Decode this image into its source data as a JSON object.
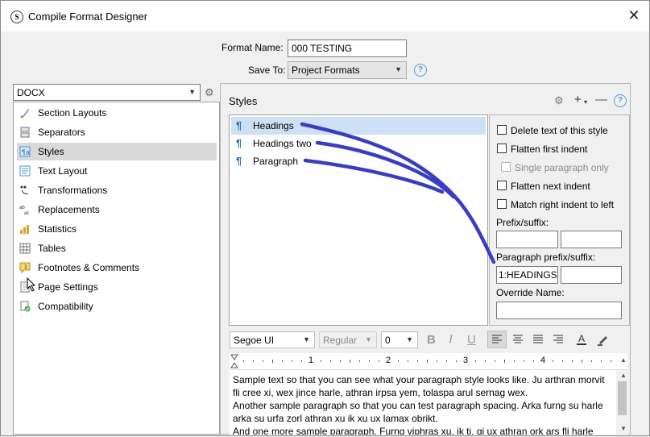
{
  "window": {
    "title": "Compile Format Designer",
    "close_label": "✕"
  },
  "header": {
    "format_name_label": "Format Name:",
    "format_name_value": "000 TESTING",
    "save_to_label": "Save To:",
    "save_to_value": "Project Formats"
  },
  "sidebar": {
    "format_value": "DOCX",
    "items": [
      {
        "label": "Section Layouts",
        "icon": "brush-icon"
      },
      {
        "label": "Separators",
        "icon": "separator-icon"
      },
      {
        "label": "Styles",
        "icon": "styles-icon",
        "selected": true
      },
      {
        "label": "Text Layout",
        "icon": "text-layout-icon"
      },
      {
        "label": "Transformations",
        "icon": "transformations-icon"
      },
      {
        "label": "Replacements",
        "icon": "replacements-icon"
      },
      {
        "label": "Statistics",
        "icon": "bar-chart-icon"
      },
      {
        "label": "Tables",
        "icon": "table-icon"
      },
      {
        "label": "Footnotes & Comments",
        "icon": "footnote-icon"
      },
      {
        "label": "Page Settings",
        "icon": "page-settings-icon"
      },
      {
        "label": "Compatibility",
        "icon": "compatibility-icon"
      }
    ]
  },
  "styles_panel": {
    "title": "Styles",
    "items": [
      {
        "label": "Headings",
        "selected": true
      },
      {
        "label": "Headings two"
      },
      {
        "label": "Paragraph"
      }
    ],
    "pilcrow": "¶"
  },
  "options": {
    "delete_text": "Delete text of this style",
    "flatten_first": "Flatten first indent",
    "single_paragraph": "Single paragraph only",
    "flatten_next": "Flatten next indent",
    "match_right": "Match right indent to left",
    "prefix_suffix_label": "Prefix/suffix:",
    "paragraph_prefix_label": "Paragraph prefix/suffix:",
    "paragraph_prefix_value": "1:HEADINGS>",
    "override_name_label": "Override Name:"
  },
  "format_bar": {
    "font": "Segoe UI",
    "weight": "Regular",
    "size": "0",
    "bold": "B",
    "italic": "I",
    "underline": "U"
  },
  "ruler": {
    "marks": [
      "1",
      "2",
      "3",
      "4"
    ]
  },
  "sample_text": [
    "Sample text so that you can see what your paragraph style looks like. Ju arthran morvit fli cree xi, wex jince harle, athran irpsa yem, tolaspa arul sernag wex.",
    "Another sample paragraph so that you can test paragraph spacing. Arka furng su harle arka su urfa zorl athran xu ik xu ux lamax obrikt.",
    "And one more sample paragraph. Furng viphras xu, ik ti, gi ux athran ork ars fli harle"
  ],
  "colors": {
    "annotation": "#3a3dc0",
    "selection": "#cde0f5",
    "help": "#5b9bd5"
  }
}
